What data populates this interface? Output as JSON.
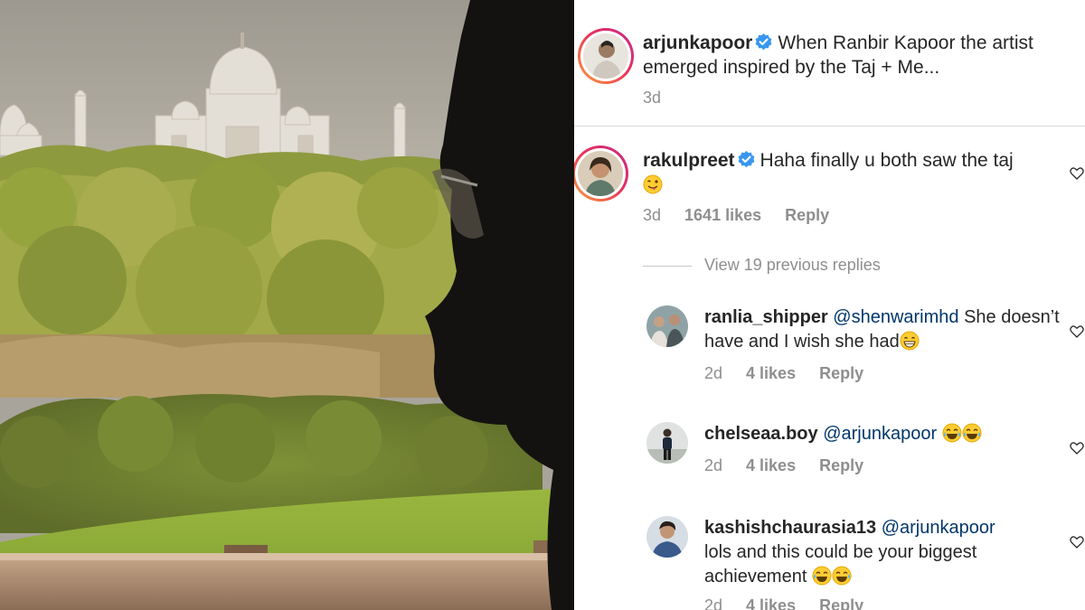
{
  "post": {
    "username": "arjunkapoor",
    "caption": "When Ranbir Kapoor the artist emerged inspired by the Taj + Me...",
    "time": "3d"
  },
  "comments": [
    {
      "username": "rakulpreet",
      "verified": true,
      "text": "Haha finally u both saw the taj",
      "emoji": "winking-tongue-emoji",
      "time": "3d",
      "likes": "1641 likes",
      "reply_label": "Reply",
      "view_replies": "View 19 previous replies",
      "replies": [
        {
          "username": "ranlia_shipper",
          "mention": "@shenwarimhd",
          "text": "She doesn’t have and I wish she had",
          "emoji": "grinning-emoji",
          "time": "2d",
          "likes": "4 likes",
          "reply_label": "Reply"
        },
        {
          "username": "chelseaa.boy",
          "mention": "@arjunkapoor",
          "text": "",
          "emoji": "tears-of-joy-emoji",
          "time": "2d",
          "likes": "4 likes",
          "reply_label": "Reply"
        },
        {
          "username": "kashishchaurasia13",
          "mention": "@arjunkapoor",
          "text": "lols and this could be your biggest achievement",
          "emoji": "laughing-emoji",
          "time": "2d",
          "likes": "4 likes",
          "reply_label": "Reply"
        }
      ]
    }
  ],
  "colors": {
    "text": "#262626",
    "muted": "#8e8e8e",
    "mention": "#00376b",
    "verified": "#3897f0",
    "divider": "#dbdbdb"
  }
}
